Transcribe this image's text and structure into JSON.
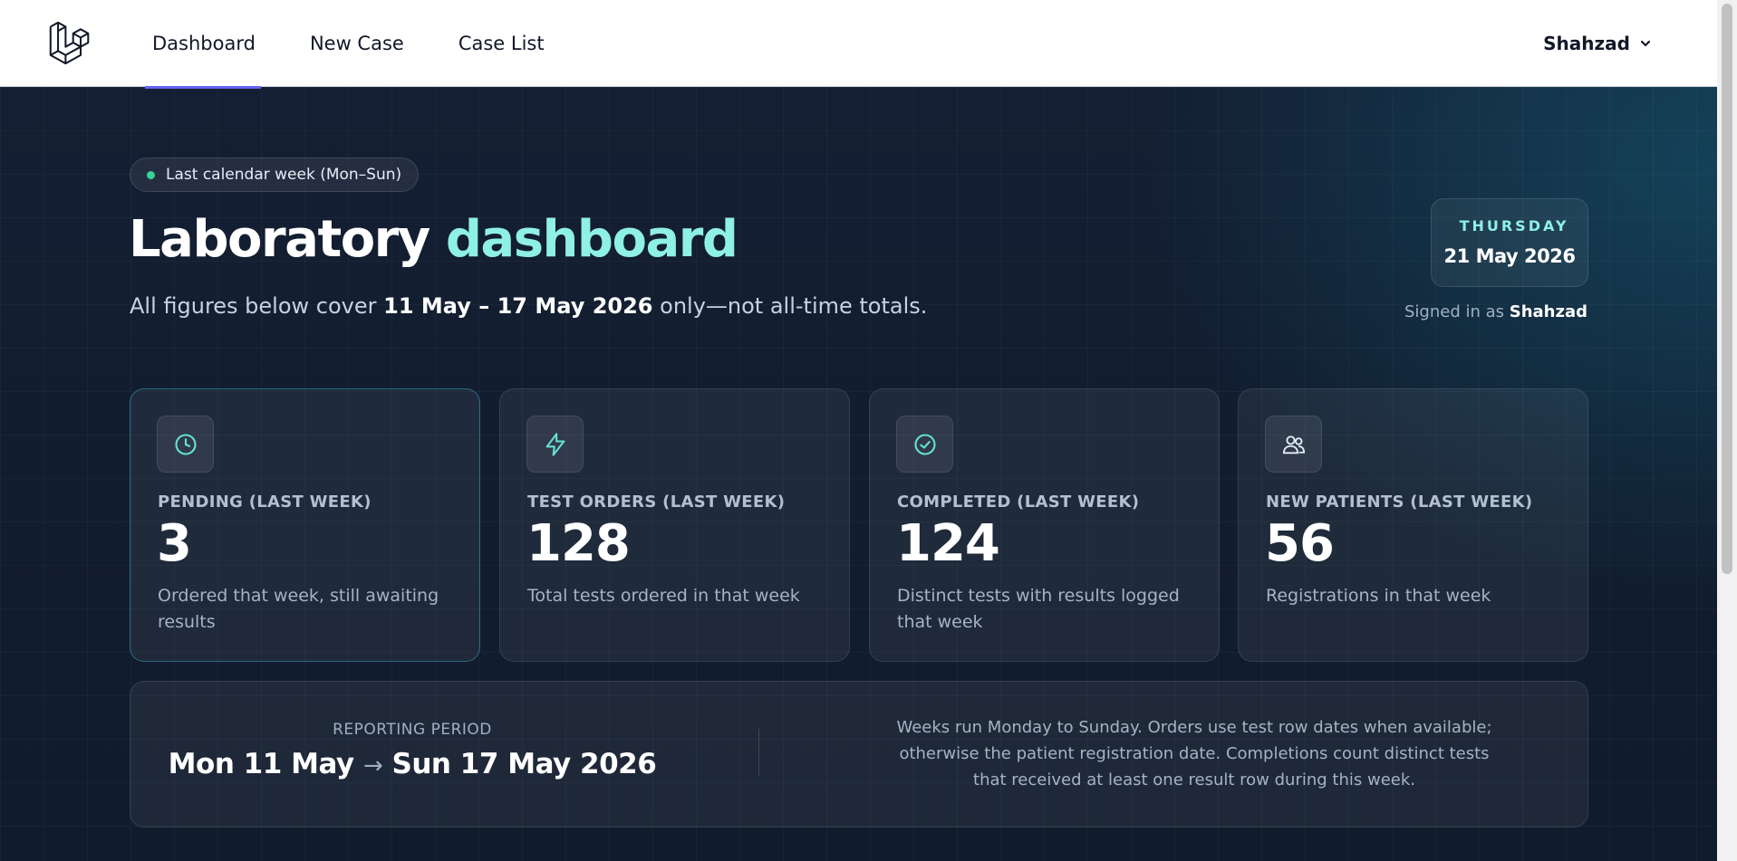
{
  "nav": {
    "items": [
      {
        "label": "Dashboard",
        "active": true
      },
      {
        "label": "New Case",
        "active": false
      },
      {
        "label": "Case List",
        "active": false
      }
    ],
    "user": "Shahzad",
    "logo_icon": "laravel-logo-icon",
    "dropdown_icon": "chevron-down-icon"
  },
  "header": {
    "badge": "Last calendar week (Mon–Sun)",
    "title_main": "Laboratory",
    "title_accent": "dashboard",
    "subtitle_prefix": "All figures below cover",
    "subtitle_range": "11 May – 17 May 2026",
    "subtitle_suffix": "only—not all-time totals.",
    "weekday": "THURSDAY",
    "date": "21 May 2026",
    "signed_prefix": "Signed in as",
    "signed_user": "Shahzad"
  },
  "stats": [
    {
      "label": "PENDING (LAST WEEK)",
      "value": "3",
      "desc": "Ordered that week, still awaiting results",
      "icon": "clock-icon"
    },
    {
      "label": "TEST ORDERS (LAST WEEK)",
      "value": "128",
      "desc": "Total tests ordered in that week",
      "icon": "lightning-icon"
    },
    {
      "label": "COMPLETED (LAST WEEK)",
      "value": "124",
      "desc": "Distinct tests with results logged that week",
      "icon": "check-circle-icon"
    },
    {
      "label": "NEW PATIENTS (LAST WEEK)",
      "value": "56",
      "desc": "Registrations in that week",
      "icon": "users-icon"
    }
  ],
  "period": {
    "label": "REPORTING PERIOD",
    "start": "Mon 11 May",
    "arrow": "→",
    "end": "Sun 17 May 2026",
    "note": "Weeks run Monday to Sunday. Orders use test row dates when available; otherwise the patient registration date. Completions count distinct tests that received at least one result row during this week."
  },
  "colors": {
    "accent": "#8ff0e4",
    "active_nav": "#6366f1",
    "status_dot": "#34d399"
  }
}
